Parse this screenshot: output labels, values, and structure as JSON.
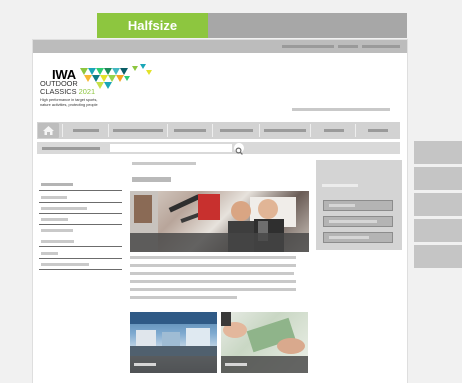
{
  "tabs": {
    "active_label": "Halfsize"
  },
  "logo": {
    "brand": "IWA",
    "line1": "OUTDOOR",
    "line2": "CLASSICS",
    "year": "2021",
    "tagline1": "High performance in target sports,",
    "tagline2": "nature activities, protecting people"
  },
  "colors": {
    "accent": "#8dc63f",
    "frame": "#ffffff",
    "placeholder": "#c9c9c9"
  },
  "icons": {
    "home": "home-icon",
    "search": "search-icon"
  }
}
